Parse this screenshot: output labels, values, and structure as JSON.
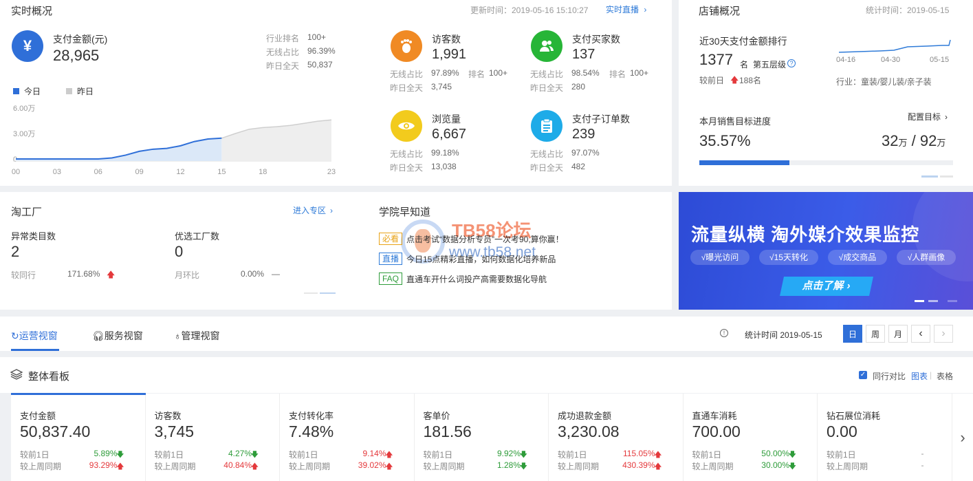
{
  "realtime": {
    "title": "实时概况",
    "update_time": "更新时间：2019-05-16 15:10:27",
    "live_link": "实时直播",
    "pay_amount": {
      "label": "支付金额(元)",
      "value": "28,965",
      "rank_label": "行业排名",
      "rank_value": "100+",
      "wireless_label": "无线占比",
      "wireless_value": "96.39%",
      "yesterday_label": "昨日全天",
      "yesterday_value": "50,837"
    },
    "legend_today": "今日",
    "legend_yesterday": "昨日",
    "visitors": {
      "label": "访客数",
      "value": "1,991",
      "wireless_label": "无线占比",
      "wireless_value": "97.89%",
      "rank_label": "排名",
      "rank_value": "100+",
      "yesterday_label": "昨日全天",
      "yesterday_value": "3,745"
    },
    "buyers": {
      "label": "支付买家数",
      "value": "137",
      "wireless_label": "无线占比",
      "wireless_value": "98.54%",
      "rank_label": "排名",
      "rank_value": "100+",
      "yesterday_label": "昨日全天",
      "yesterday_value": "280"
    },
    "pageviews": {
      "label": "浏览量",
      "value": "6,667",
      "wireless_label": "无线占比",
      "wireless_value": "99.18%",
      "yesterday_label": "昨日全天",
      "yesterday_value": "13,038"
    },
    "suborders": {
      "label": "支付子订单数",
      "value": "239",
      "wireless_label": "无线占比",
      "wireless_value": "97.07%",
      "yesterday_label": "昨日全天",
      "yesterday_value": "482"
    }
  },
  "chart_data": {
    "type": "area",
    "x_ticks": [
      "00",
      "03",
      "06",
      "09",
      "12",
      "15",
      "18",
      "23"
    ],
    "y_ticks": [
      "6.00万",
      "3.00万",
      "0"
    ],
    "ylim": [
      0,
      60000
    ],
    "series": [
      {
        "name": "今日",
        "x": [
          0,
          3,
          6,
          7,
          8,
          9,
          10,
          11,
          12,
          13,
          14,
          15
        ],
        "values": [
          0,
          0,
          0,
          1200,
          4500,
          9000,
          11500,
          12500,
          15500,
          20500,
          23500,
          24500
        ]
      },
      {
        "name": "昨日",
        "x": [
          15,
          16,
          17,
          18,
          19,
          20,
          21,
          22,
          23
        ],
        "values": [
          24500,
          30000,
          35000,
          37000,
          38000,
          39500,
          42000,
          44500,
          46000
        ]
      }
    ]
  },
  "shop": {
    "title": "店铺概况",
    "stat_time": "统计时间：2019-05-15",
    "rank_title": "近30天支付金额排行",
    "rank_value": "1377",
    "rank_unit": "名",
    "tier": "第五层级",
    "compare_label": "较前日",
    "compare_value": "188名",
    "mini_ticks": [
      "04-16",
      "04-30",
      "05-15"
    ],
    "industry": "行业：童装/婴儿装/亲子装",
    "goal_title": "本月销售目标进度",
    "goal_link": "配置目标",
    "goal_percent": "35.57%",
    "goal_progress": 0.3557,
    "goal_done": "32",
    "goal_total": "92",
    "goal_unit": "万"
  },
  "factory": {
    "title": "淘工厂",
    "enter_link": "进入专区",
    "abnormal_label": "异常类目数",
    "abnormal_value": "2",
    "abnormal_cmp_label": "较同行",
    "abnormal_cmp_value": "171.68%",
    "preferred_label": "优选工厂数",
    "preferred_value": "0",
    "preferred_cmp_label": "月环比",
    "preferred_cmp_value": "0.00%",
    "preferred_cmp_arrow": "—"
  },
  "academy": {
    "title": "学院早知道",
    "items": [
      {
        "tag": "必看",
        "text": "点击考试“数据分析专员”一次考90,算你赢！",
        "color": "#e8a317"
      },
      {
        "tag": "直播",
        "text": "今日15点精彩直播，如何数据化培养新品",
        "color": "#2f7bd8"
      },
      {
        "tag": "FAQ",
        "text": "直通车开什么词投产高需要数据化导航",
        "color": "#2e9c3a"
      }
    ]
  },
  "watermark": {
    "title": "TB58论坛",
    "url": "www.tb58.net"
  },
  "banner": {
    "headline": "流量纵横 淘外媒介效果监控",
    "chips": [
      "√曝光访问",
      "√15天转化",
      "√成交商品",
      "√人群画像"
    ],
    "cta": "点击了解"
  },
  "views": {
    "tabs": [
      "运营视窗",
      "服务视窗",
      "管理视窗"
    ],
    "stat_time": "统计时间 2019-05-15",
    "period_buttons": [
      "日",
      "周",
      "月"
    ],
    "prev_icon": "‹",
    "next_icon": "›"
  },
  "dashboard": {
    "title": "整体看板",
    "compare_label": "同行对比",
    "chart_link": "图表",
    "table_link": "表格",
    "next_icon": "›",
    "metrics": [
      {
        "name": "支付金额",
        "value": "50,837.40",
        "r1_label": "较前1日",
        "r1_value": "5.89%",
        "r1_dir": "down",
        "r2_label": "较上周同期",
        "r2_value": "93.29%",
        "r2_dir": "up"
      },
      {
        "name": "访客数",
        "value": "3,745",
        "r1_label": "较前1日",
        "r1_value": "4.27%",
        "r1_dir": "down",
        "r2_label": "较上周同期",
        "r2_value": "40.84%",
        "r2_dir": "up"
      },
      {
        "name": "支付转化率",
        "value": "7.48%",
        "r1_label": "较前1日",
        "r1_value": "9.14%",
        "r1_dir": "up",
        "r2_label": "较上周同期",
        "r2_value": "39.02%",
        "r2_dir": "up"
      },
      {
        "name": "客单价",
        "value": "181.56",
        "r1_label": "较前1日",
        "r1_value": "9.92%",
        "r1_dir": "down",
        "r2_label": "较上周同期",
        "r2_value": "1.28%",
        "r2_dir": "down"
      },
      {
        "name": "成功退款金额",
        "value": "3,230.08",
        "r1_label": "较前1日",
        "r1_value": "115.05%",
        "r1_dir": "up",
        "r2_label": "较上周同期",
        "r2_value": "430.39%",
        "r2_dir": "up"
      },
      {
        "name": "直通车消耗",
        "value": "700.00",
        "r1_label": "较前1日",
        "r1_value": "50.00%",
        "r1_dir": "down",
        "r2_label": "较上周同期",
        "r2_value": "30.00%",
        "r2_dir": "down"
      },
      {
        "name": "钻石展位消耗",
        "value": "0.00",
        "r1_label": "较前1日",
        "r1_value": "-",
        "r1_dir": "none",
        "r2_label": "较上周同期",
        "r2_value": "-",
        "r2_dir": "none"
      }
    ]
  }
}
